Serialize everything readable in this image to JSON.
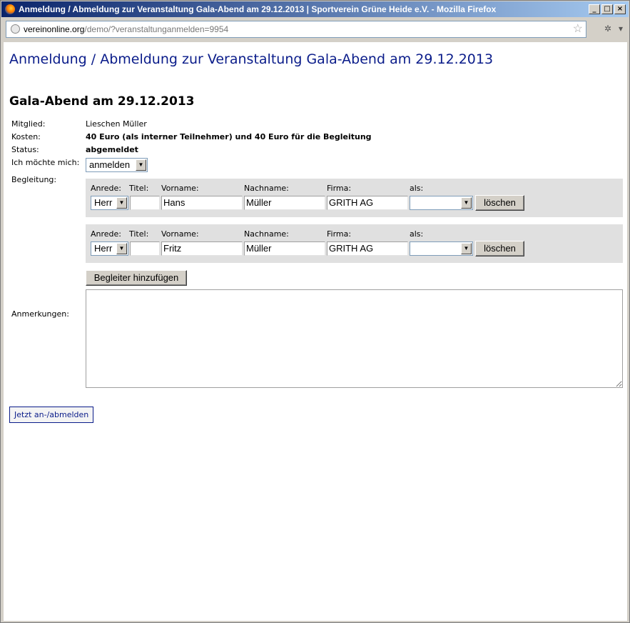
{
  "window": {
    "title": "Anmeldung / Abmeldung zur Veranstaltung Gala-Abend am 29.12.2013 | Sportverein Grüne Heide e.V. - Mozilla Firefox",
    "controls": [
      "_",
      "□",
      "×"
    ]
  },
  "address_bar": {
    "host": "vereinonline.org",
    "path": "/demo/?veranstaltunganmelden=9954"
  },
  "page": {
    "heading": "Anmeldung / Abmeldung zur Veranstaltung Gala-Abend am 29.12.2013",
    "event_title": "Gala-Abend am 29.12.2013",
    "fields": {
      "member_label": "Mitglied:",
      "member_value": "Lieschen Müller",
      "cost_label": "Kosten:",
      "cost_value": "40 Euro (als interner Teilnehmer) und 40 Euro für die Begleitung",
      "status_label": "Status:",
      "status_value": "abgemeldet",
      "action_label": "Ich möchte mich:",
      "action_value": "anmelden",
      "companion_label": "Begleitung:",
      "remarks_label": "Anmerkungen:"
    },
    "companion_headers": {
      "salutation": "Anrede:",
      "title": "Titel:",
      "first_name": "Vorname:",
      "last_name": "Nachname:",
      "company": "Firma:",
      "as": "als:"
    },
    "companions": [
      {
        "salutation": "Herr",
        "title": "",
        "first_name": "Hans",
        "last_name": "Müller",
        "company": "GRITH AG",
        "as": "",
        "delete_label": "löschen"
      },
      {
        "salutation": "Herr",
        "title": "",
        "first_name": "Fritz",
        "last_name": "Müller",
        "company": "GRITH AG",
        "as": "",
        "delete_label": "löschen"
      }
    ],
    "add_companion_label": "Begleiter hinzufügen",
    "submit_label": "Jetzt an-/abmelden"
  }
}
